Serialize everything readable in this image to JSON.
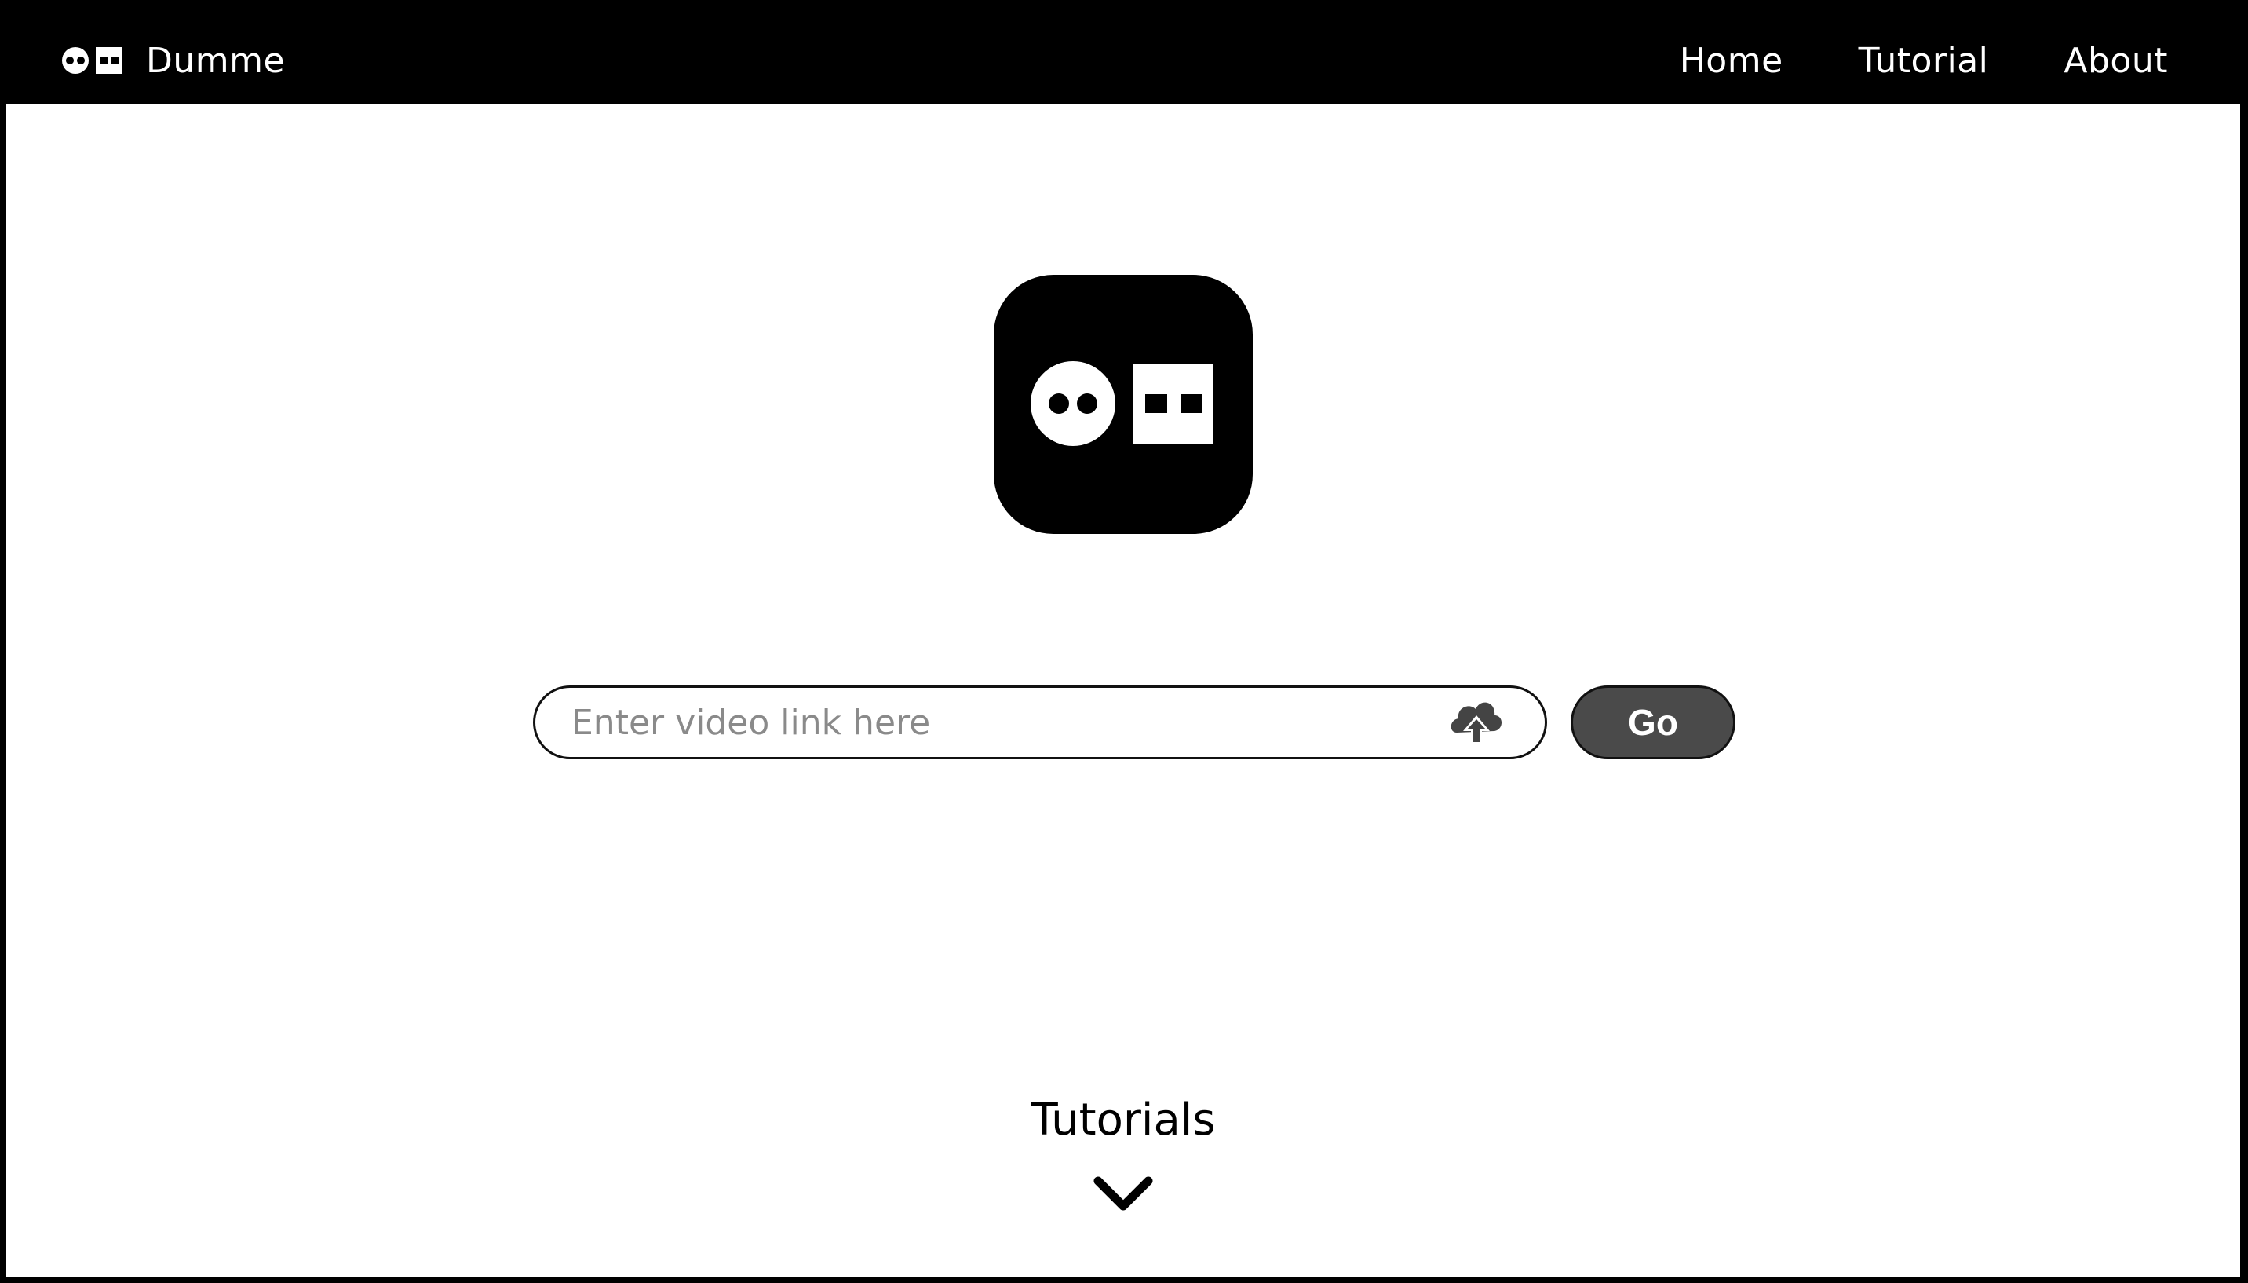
{
  "navbar": {
    "brand_name": "Dumme",
    "links": [
      {
        "label": "Home"
      },
      {
        "label": "Tutorial"
      },
      {
        "label": "About"
      }
    ]
  },
  "hero": {
    "logo_icon": "dumme-logo-icon"
  },
  "search": {
    "placeholder": "Enter video link here",
    "value": "",
    "upload_icon": "cloud-upload-icon"
  },
  "go_button": {
    "label": "Go"
  },
  "tutorials": {
    "title": "Tutorials",
    "expand_icon": "chevron-down-icon"
  },
  "colors": {
    "navbar_bg": "#000000",
    "page_bg": "#ffffff",
    "button_bg": "#4a4a4a",
    "button_text": "#ffffff",
    "placeholder": "#8a8a8a"
  }
}
